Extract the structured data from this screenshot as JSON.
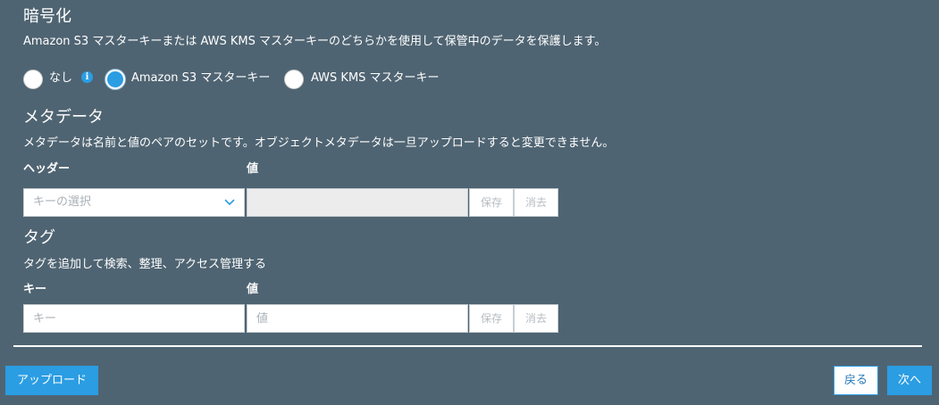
{
  "encryption": {
    "title": "暗号化",
    "description": "Amazon S3 マスターキーまたは AWS KMS マスターキーのどちらかを使用して保管中のデータを保護します。",
    "options": [
      {
        "label": "なし",
        "selected": false
      },
      {
        "label": "Amazon S3 マスターキー",
        "selected": true
      },
      {
        "label": "AWS KMS マスターキー",
        "selected": false
      }
    ],
    "info_icon_glyph": "i"
  },
  "metadata": {
    "title": "メタデータ",
    "description": "メタデータは名前と値のペアのセットです。オブジェクトメタデータは一旦アップロードすると変更できません。",
    "header_label": "ヘッダー",
    "value_label": "値",
    "select_placeholder": "キーの選択",
    "save_label": "保存",
    "clear_label": "消去"
  },
  "tags": {
    "title": "タグ",
    "description": "タグを追加して検索、整理、アクセス管理する",
    "key_label": "キー",
    "value_label": "値",
    "key_placeholder": "キー",
    "value_placeholder": "値",
    "save_label": "保存",
    "clear_label": "消去"
  },
  "footer": {
    "upload_label": "アップロード",
    "back_label": "戻る",
    "next_label": "次へ"
  },
  "colors": {
    "background": "#4f6472",
    "accent": "#2b9de3"
  }
}
